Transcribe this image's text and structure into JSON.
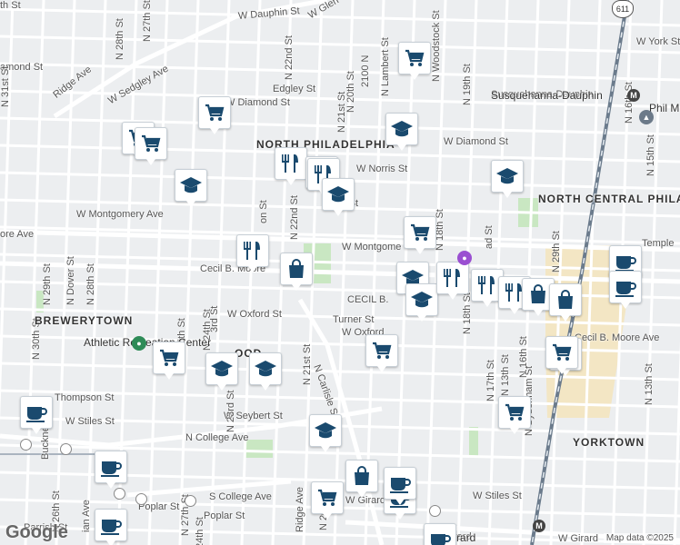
{
  "map": {
    "credit": "Map data ©2025",
    "logo": "Google",
    "colors": {
      "background": "#eceef0",
      "street": "#ffffff",
      "park": "#c9e7c2",
      "campus": "#f3e6c4",
      "rail": "#6b7b8c",
      "marker_icon": "#1a4a6e",
      "marker_bg": "#ffffff"
    },
    "highway_shield": "611"
  },
  "labels": {
    "street_names": [
      "W Dauphin St",
      "W Glen",
      "W York St",
      "amond St",
      "W Sedgley Ave",
      "Ridge Ave",
      "Edgley St",
      "W Diamond St",
      "W Diamond St",
      "Susquehanna-Dauphin",
      "W Norris St",
      "rks St",
      "W Montgomery Ave",
      "W Montgome",
      "ore Ave",
      "Cecil B. Moore",
      "CECIL B.",
      "W Oxford St",
      "Turner St",
      "W Oxford",
      "Cecil B. Moore Ave",
      "Thompson St",
      "W Stiles St",
      "W Seybert St",
      "N College Ave",
      "S College Ave",
      "W Stiles St",
      "Poplar St",
      "Poplar St",
      "Parrish St",
      "W Girard",
      "W Girard",
      "oad-Girard",
      "Temple",
      "N 31st St",
      "N 30th St",
      "N 29th St",
      "N Dover St",
      "N 28th St",
      "N 28th St",
      "N 27th St",
      "N 26th St",
      "N 25th St",
      "N 24th St",
      "N 23rd St",
      "N 22nd St",
      "N 22nd St",
      "N 21st St",
      "N 21st St",
      "N 20th",
      "N 20th St",
      "2100 N",
      "N Lambert St",
      "N Woodstock St",
      "N 19th St",
      "N 18th St",
      "N 18th St",
      "N 17th St",
      "N 16th St",
      "N 16th St",
      "N 15th St",
      "N 13th St",
      "N 13th St",
      "N Sydenham St",
      "N Carlisle St",
      "Ridge Ave",
      "ian Ave",
      "N 27th St",
      "24th St",
      "Bucknell St",
      "N 29th St",
      "ad St",
      "on St",
      "3rd St",
      "th St"
    ],
    "neighborhoods": [
      "NORTH PHILADELPHIA",
      "NORTH CENTRAL PHILADELPHIA",
      "BREWERYTOWN",
      "YORKTOWN",
      "OOD"
    ],
    "places": [
      "Athletic Recreation Center",
      "Phil Mill",
      "Susquehanna-Dauphin",
      "oad-Girard"
    ]
  },
  "markers": [
    {
      "kind": "grocery",
      "icon": "shopping-cart-icon"
    },
    {
      "kind": "grocery",
      "icon": "shopping-cart-icon"
    },
    {
      "kind": "grocery",
      "icon": "shopping-cart-icon"
    },
    {
      "kind": "grocery",
      "icon": "shopping-cart-icon"
    },
    {
      "kind": "school",
      "icon": "graduation-cap-icon"
    },
    {
      "kind": "restaurant",
      "icon": "fork-knife-icon"
    },
    {
      "kind": "restaurant",
      "icon": "fork-knife-icon"
    },
    {
      "kind": "restaurant",
      "icon": "fork-knife-icon"
    },
    {
      "kind": "school",
      "icon": "graduation-cap-icon"
    },
    {
      "kind": "school",
      "icon": "graduation-cap-icon"
    },
    {
      "kind": "school",
      "icon": "graduation-cap-icon"
    },
    {
      "kind": "grocery",
      "icon": "shopping-cart-icon"
    },
    {
      "kind": "restaurant",
      "icon": "fork-knife-icon"
    },
    {
      "kind": "shopping",
      "icon": "shopping-bag-icon"
    },
    {
      "kind": "school",
      "icon": "graduation-cap-icon"
    },
    {
      "kind": "school",
      "icon": "graduation-cap-icon"
    },
    {
      "kind": "restaurant",
      "icon": "fork-knife-icon"
    },
    {
      "kind": "restaurant",
      "icon": "fork-knife-icon"
    },
    {
      "kind": "restaurant",
      "icon": "fork-knife-icon"
    },
    {
      "kind": "shopping",
      "icon": "shopping-bag-icon"
    },
    {
      "kind": "shopping",
      "icon": "shopping-bag-icon"
    },
    {
      "kind": "cafe",
      "icon": "coffee-cup-icon"
    },
    {
      "kind": "cafe",
      "icon": "coffee-cup-icon"
    },
    {
      "kind": "grocery",
      "icon": "shopping-cart-icon"
    },
    {
      "kind": "shopping",
      "icon": "shopping-bag-icon"
    },
    {
      "kind": "grocery",
      "icon": "shopping-cart-icon"
    },
    {
      "kind": "school",
      "icon": "graduation-cap-icon"
    },
    {
      "kind": "school",
      "icon": "graduation-cap-icon"
    },
    {
      "kind": "grocery",
      "icon": "shopping-cart-icon"
    },
    {
      "kind": "cafe",
      "icon": "coffee-cup-icon"
    },
    {
      "kind": "grocery",
      "icon": "shopping-cart-icon"
    },
    {
      "kind": "school",
      "icon": "graduation-cap-icon"
    },
    {
      "kind": "cafe",
      "icon": "coffee-cup-icon"
    },
    {
      "kind": "shopping",
      "icon": "shopping-bag-icon"
    },
    {
      "kind": "cafe",
      "icon": "coffee-cup-icon"
    },
    {
      "kind": "grocery",
      "icon": "shopping-cart-icon"
    },
    {
      "kind": "cafe",
      "icon": "coffee-cup-icon"
    },
    {
      "kind": "cafe",
      "icon": "coffee-cup-icon"
    },
    {
      "kind": "cafe",
      "icon": "coffee-cup-icon"
    }
  ]
}
